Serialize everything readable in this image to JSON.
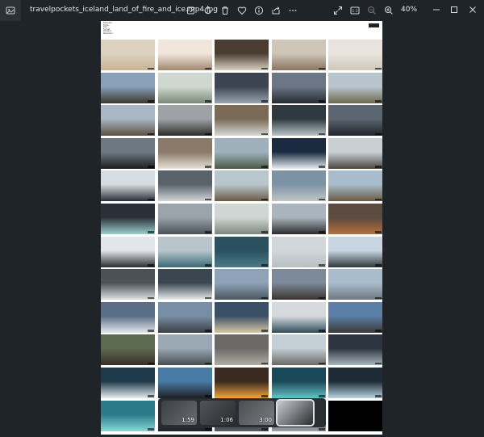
{
  "window": {
    "title": "travelpockets_iceland_land_of_fire_and_ice.mp4.jpg",
    "zoom": "40%"
  },
  "toolbar": {
    "icons": [
      "edit-image-icon",
      "rotate-icon",
      "delete-icon",
      "favorite-icon",
      "info-icon",
      "share-icon",
      "more-icon",
      "fullscreen-icon",
      "actual-size-icon",
      "zoom-out-icon",
      "zoom-in-icon"
    ]
  },
  "thumbnails": [
    {
      "colors": [
        "#ddd1bf",
        "#c9b394"
      ]
    },
    {
      "colors": [
        "#f0e6dc",
        "#a08870"
      ]
    },
    {
      "colors": [
        "#4a3c30",
        "#d8d0c2"
      ]
    },
    {
      "colors": [
        "#cfc6b8",
        "#8a7560"
      ]
    },
    {
      "colors": [
        "#e8e3dc",
        "#cfc7ba"
      ]
    },
    {
      "colors": [
        "#8aa0b8",
        "#3b3830"
      ]
    },
    {
      "colors": [
        "#cfd8d0",
        "#7b8a7a"
      ]
    },
    {
      "colors": [
        "#3b4450",
        "#9aa5b0"
      ]
    },
    {
      "colors": [
        "#6b7785",
        "#252a30"
      ]
    },
    {
      "colors": [
        "#b8c4cc",
        "#6e6a4e"
      ]
    },
    {
      "colors": [
        "#a9b7c4",
        "#5c4e40"
      ]
    },
    {
      "colors": [
        "#9ea2a6",
        "#2e2c2a"
      ]
    },
    {
      "colors": [
        "#7b6a55",
        "#d4d8d8"
      ]
    },
    {
      "colors": [
        "#2f3a40",
        "#b9c4c8"
      ]
    },
    {
      "colors": [
        "#5b6670",
        "#1f2428"
      ]
    },
    {
      "colors": [
        "#6e7880",
        "#1c1e20"
      ]
    },
    {
      "colors": [
        "#8a7a6a",
        "#e6e0d6"
      ]
    },
    {
      "colors": [
        "#9fb0bc",
        "#4b5a45"
      ]
    },
    {
      "colors": [
        "#1a2a40",
        "#e8eef2"
      ]
    },
    {
      "colors": [
        "#c9d0d4",
        "#4a4440"
      ]
    },
    {
      "colors": [
        "#d6dde2",
        "#2a3038"
      ]
    },
    {
      "colors": [
        "#5b636a",
        "#cfd4d6"
      ]
    },
    {
      "colors": [
        "#b9c6cc",
        "#6b5a46"
      ]
    },
    {
      "colors": [
        "#7c93a6",
        "#c0c6c6"
      ]
    },
    {
      "colors": [
        "#a8bccc",
        "#6a5a42"
      ]
    },
    {
      "colors": [
        "#2a3038",
        "#9ad0cf"
      ]
    },
    {
      "colors": [
        "#9aa4aa",
        "#4a5058"
      ]
    },
    {
      "colors": [
        "#cfd6d4",
        "#7c8680"
      ]
    },
    {
      "colors": [
        "#aab4bc",
        "#2a2c2e"
      ]
    },
    {
      "colors": [
        "#5a4a40",
        "#b76f3a"
      ]
    },
    {
      "colors": [
        "#e2e6ea",
        "#2a2c2e"
      ]
    },
    {
      "colors": [
        "#b8c6cc",
        "#3a6a74"
      ]
    },
    {
      "colors": [
        "#2b5060",
        "#4a7a88"
      ]
    },
    {
      "colors": [
        "#d0d6da",
        "#b8c0c4"
      ]
    },
    {
      "colors": [
        "#c8d6e4",
        "#2e3638"
      ]
    },
    {
      "colors": [
        "#4a5258",
        "#dde2e4"
      ]
    },
    {
      "colors": [
        "#3a4650",
        "#e6ecef"
      ]
    },
    {
      "colors": [
        "#8fa2b8",
        "#49565e"
      ]
    },
    {
      "colors": [
        "#7c8a9a",
        "#3a3430"
      ]
    },
    {
      "colors": [
        "#a9bccc",
        "#6e7680"
      ]
    },
    {
      "colors": [
        "#5a6e86",
        "#e4e8ec"
      ]
    },
    {
      "colors": [
        "#788ea6",
        "#3b3f44"
      ]
    },
    {
      "colors": [
        "#3a5068",
        "#d9c7a4"
      ]
    },
    {
      "colors": [
        "#d6dade",
        "#2e4d5a"
      ]
    },
    {
      "colors": [
        "#5b7fa6",
        "#3a3a38"
      ]
    },
    {
      "colors": [
        "#5c6a50",
        "#3a2e28"
      ]
    },
    {
      "colors": [
        "#9aa8b4",
        "#4a4e52"
      ]
    },
    {
      "colors": [
        "#6b6a68",
        "#b0aca4"
      ]
    },
    {
      "colors": [
        "#c4cfd6",
        "#6a6a66"
      ]
    },
    {
      "colors": [
        "#2c3440",
        "#a8b4bc"
      ]
    },
    {
      "colors": [
        "#1f3a4a",
        "#e6ecef"
      ]
    },
    {
      "colors": [
        "#4a7aa6",
        "#1e2024"
      ]
    },
    {
      "colors": [
        "#3a2a20",
        "#f2a640"
      ]
    },
    {
      "colors": [
        "#1a4a5a",
        "#6ac2c8"
      ]
    },
    {
      "colors": [
        "#1e2a36",
        "#b8d4e2"
      ]
    },
    {
      "colors": [
        "#2a7a8a",
        "#8ad8d8"
      ]
    },
    {
      "colors": [
        "#40444a",
        "#202226"
      ]
    },
    {
      "colors": [
        "#202226",
        "#5a5e64"
      ]
    },
    {
      "colors": [
        "#2a2c30",
        "#a0a4a8"
      ]
    },
    {
      "colors": [
        "#000000",
        "#000000"
      ]
    }
  ],
  "sheet": {
    "meta_lines": [
      "Filename:",
      "Folder:",
      "Size:",
      "Format:",
      "Duration:",
      "Resolution:"
    ],
    "footer": ""
  },
  "strip": {
    "frames": [
      {
        "colors": [
          "#3a3d42",
          "#6a6e74"
        ],
        "duration": "1:59",
        "selected": false
      },
      {
        "colors": [
          "#505458",
          "#2a2d30"
        ],
        "duration": "1:06",
        "selected": false
      },
      {
        "colors": [
          "#4a4d50",
          "#7a7e82"
        ],
        "duration": "3:00",
        "selected": false
      },
      {
        "colors": [
          "#c8ccd0",
          "#2a2c30"
        ],
        "duration": "",
        "selected": true
      }
    ]
  }
}
